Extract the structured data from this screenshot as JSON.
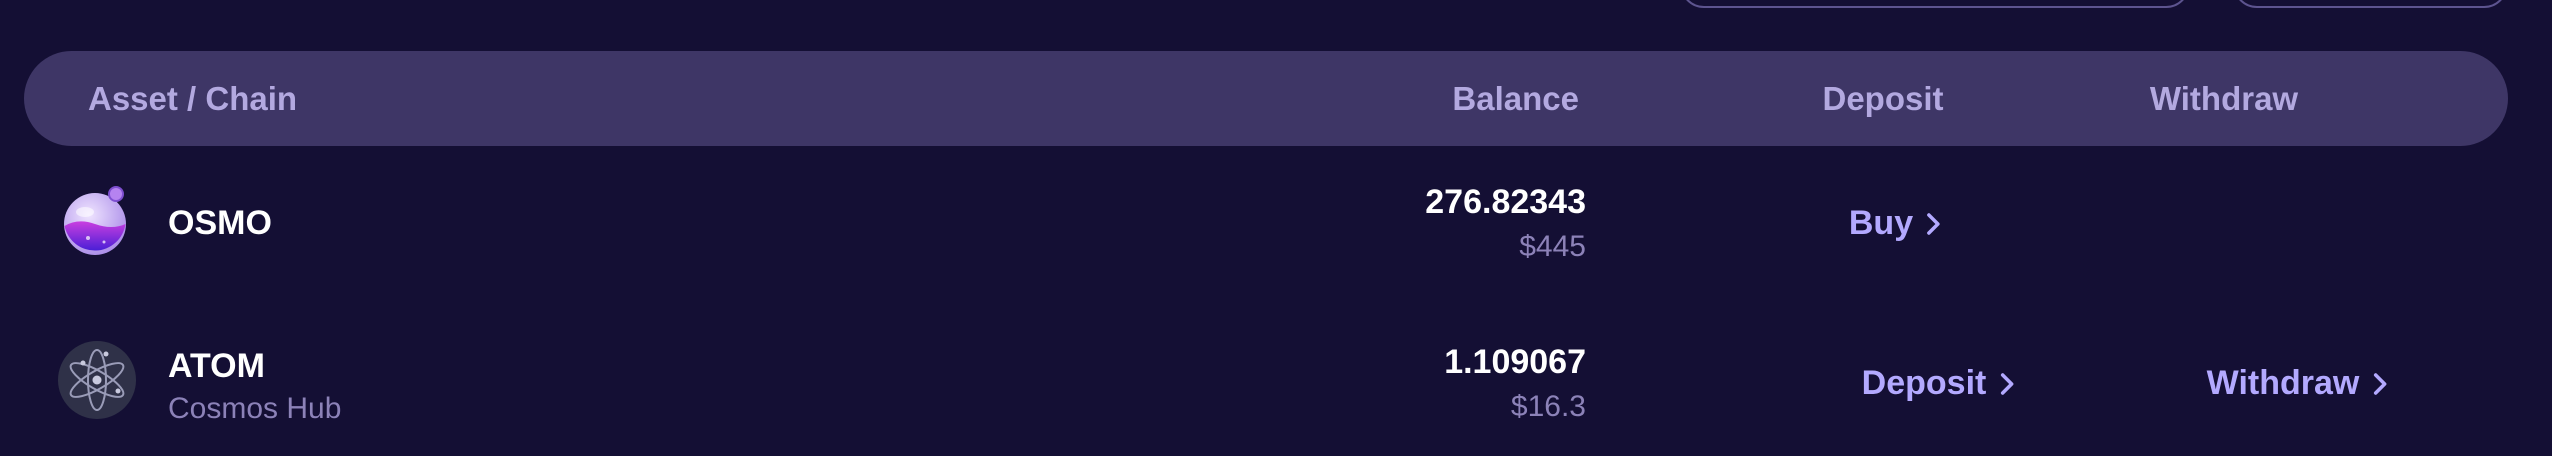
{
  "header": {
    "asset_chain": "Asset / Chain",
    "balance": "Balance",
    "deposit": "Deposit",
    "withdraw": "Withdraw"
  },
  "rows": [
    {
      "symbol": "OSMO",
      "chain": "",
      "icon": "osmosis-logo-icon",
      "balance": "276.82343",
      "fiat": "$445",
      "deposit_label": "Buy",
      "withdraw_label": ""
    },
    {
      "symbol": "ATOM",
      "chain": "Cosmos Hub",
      "icon": "cosmos-atom-logo-icon",
      "balance": "1.109067",
      "fiat": "$16.3",
      "deposit_label": "Deposit",
      "withdraw_label": "Withdraw"
    }
  ],
  "colors": {
    "background": "#140f34",
    "header_bg": "#3e3666",
    "header_text": "#b3a9e0",
    "action": "#b3a9ff",
    "muted": "#8c82b8"
  }
}
